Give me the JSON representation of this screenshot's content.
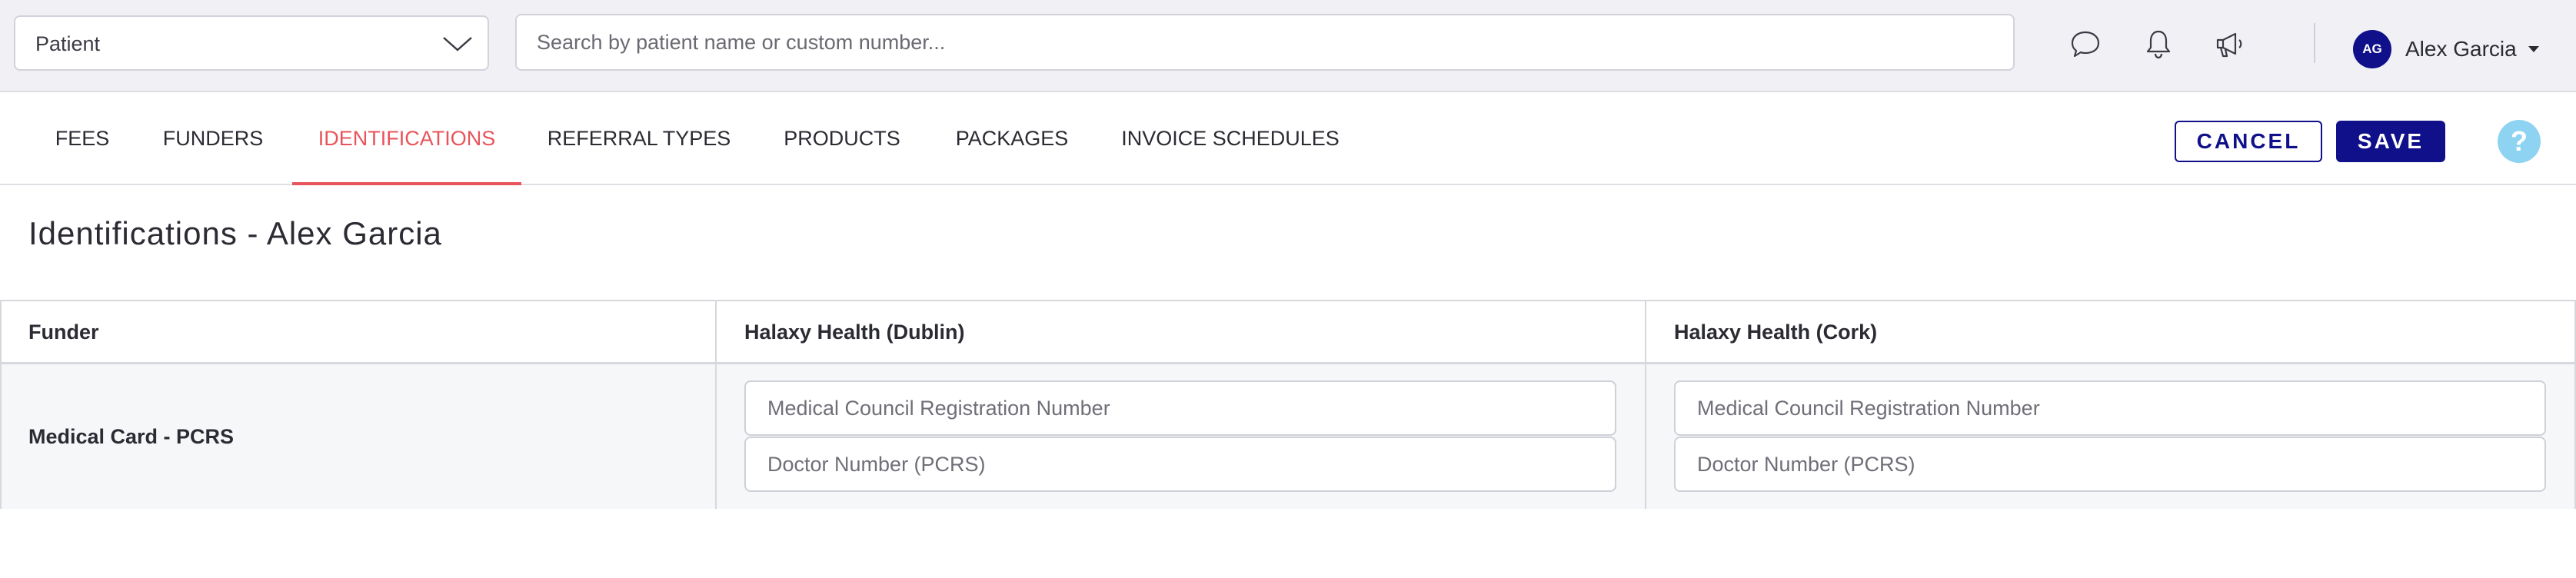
{
  "topbar": {
    "type_select": {
      "value": "Patient",
      "icon": "chevron-down-icon"
    },
    "search": {
      "placeholder": "Search by patient name or custom number..."
    },
    "icons": [
      "chat-icon",
      "bell-icon",
      "megaphone-icon"
    ],
    "user": {
      "initials": "AG",
      "name": "Alex Garcia"
    }
  },
  "tabs": [
    {
      "label": "FEES",
      "active": false
    },
    {
      "label": "FUNDERS",
      "active": false
    },
    {
      "label": "IDENTIFICATIONS",
      "active": true
    },
    {
      "label": "REFERRAL TYPES",
      "active": false
    },
    {
      "label": "PRODUCTS",
      "active": false
    },
    {
      "label": "PACKAGES",
      "active": false
    },
    {
      "label": "INVOICE SCHEDULES",
      "active": false
    }
  ],
  "actions": {
    "cancel": "CANCEL",
    "save": "SAVE",
    "help": "?"
  },
  "page": {
    "title": "Identifications - Alex Garcia"
  },
  "table": {
    "headers": [
      "Funder",
      "Halaxy Health (Dublin)",
      "Halaxy Health (Cork)"
    ],
    "rows": [
      {
        "funder": "Medical Card - PCRS",
        "cells": [
          {
            "fields": [
              {
                "placeholder": "Medical Council Registration Number",
                "value": ""
              },
              {
                "placeholder": "Doctor Number (PCRS)",
                "value": ""
              }
            ]
          },
          {
            "fields": [
              {
                "placeholder": "Medical Council Registration Number",
                "value": ""
              },
              {
                "placeholder": "Doctor Number (PCRS)",
                "value": ""
              }
            ]
          }
        ]
      }
    ]
  },
  "colors": {
    "primary": "#10108a",
    "active_tab": "#e8545b",
    "help": "#8fd3f2"
  }
}
